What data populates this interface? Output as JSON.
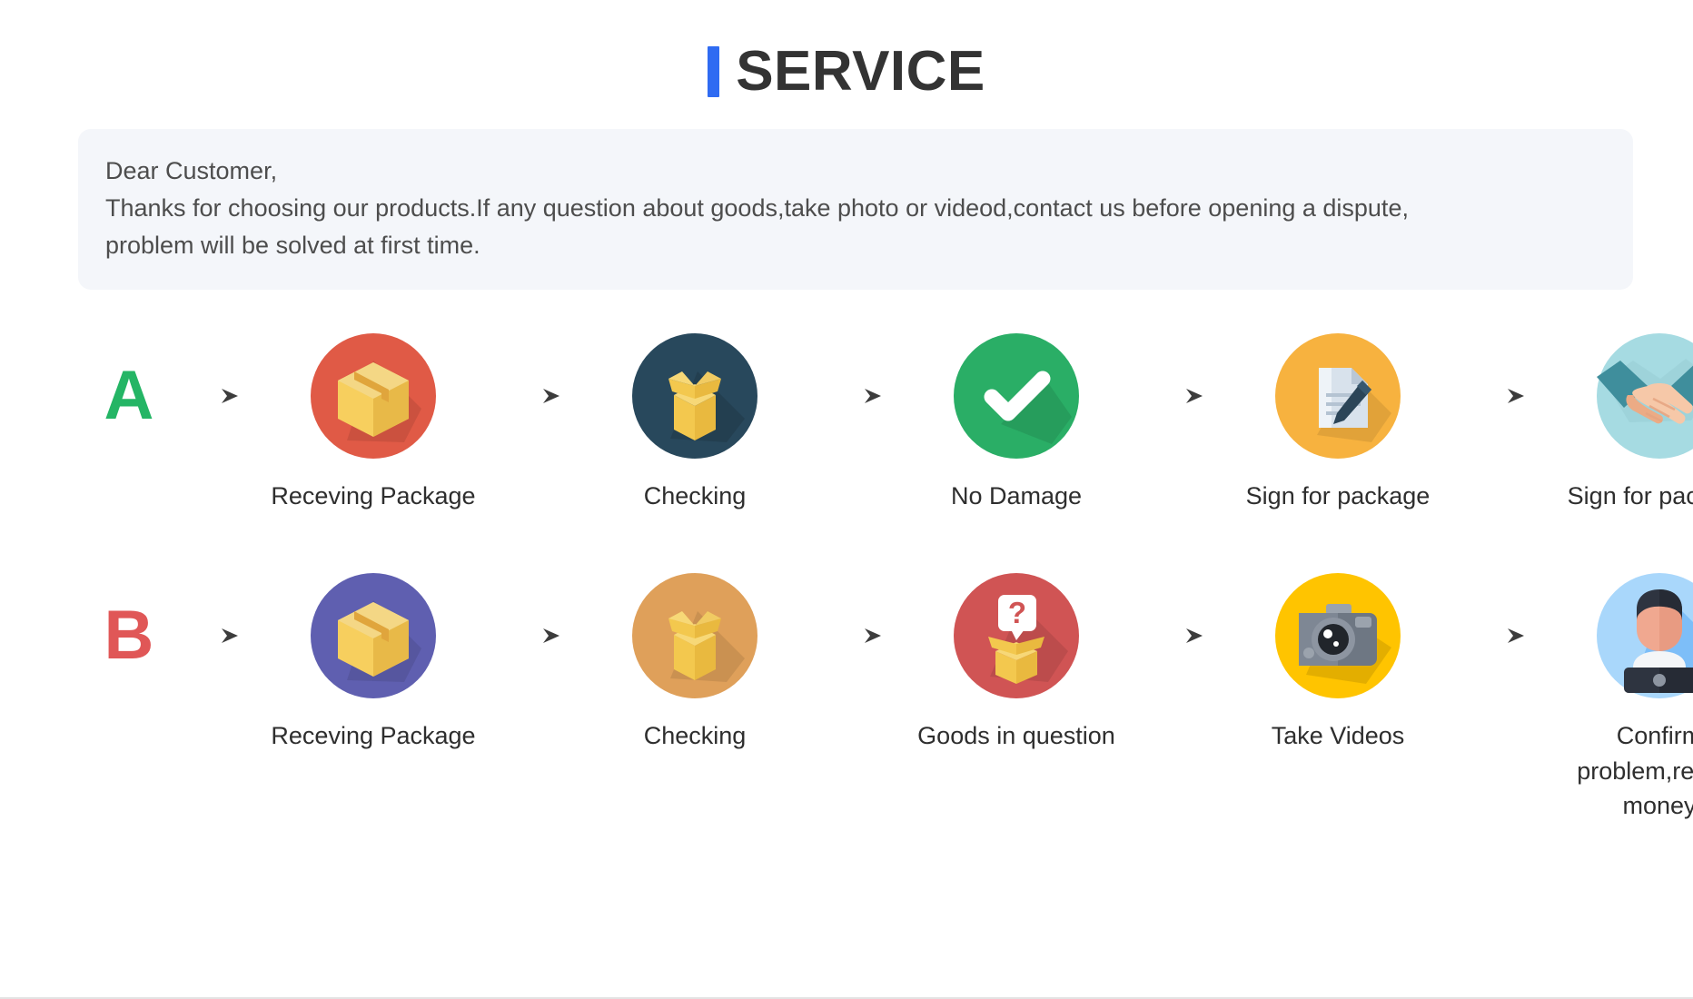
{
  "header": {
    "accent_color": "#2f6bf2",
    "title": "SERVICE"
  },
  "notice": {
    "greeting": "Dear Customer,",
    "line1": "Thanks for choosing our products.If any question about goods,take photo or videod,contact us before opening a dispute,",
    "line2": "problem will be solved at first time.",
    "background_color": "#f4f6fa"
  },
  "flows": [
    {
      "badge": "A",
      "badge_color": "#24b565",
      "steps": [
        {
          "label": "Receving Package",
          "icon": "closed-box-icon",
          "circle_color": "#e05a46"
        },
        {
          "label": "Checking",
          "icon": "open-box-icon",
          "circle_color": "#28485c"
        },
        {
          "label": "No Damage",
          "icon": "check-mark-icon",
          "circle_color": "#2aae66"
        },
        {
          "label": "Sign for package",
          "icon": "document-pen-icon",
          "circle_color": "#f7b23f"
        },
        {
          "label": "Sign for package",
          "icon": "handshake-icon",
          "circle_color": "#a6dbe2"
        }
      ]
    },
    {
      "badge": "B",
      "badge_color": "#e05757",
      "steps": [
        {
          "label": "Receving Package",
          "icon": "closed-box-icon",
          "circle_color": "#5f5fb0"
        },
        {
          "label": "Checking",
          "icon": "open-box-icon",
          "circle_color": "#dfa05a"
        },
        {
          "label": "Goods in question",
          "icon": "question-box-icon",
          "circle_color": "#d05454"
        },
        {
          "label": "Take Videos",
          "icon": "camera-icon",
          "circle_color": "#ffc400"
        },
        {
          "label": "Confirm  problem,refund money",
          "icon": "support-agent-icon",
          "circle_color": "#a9d7fb"
        }
      ]
    }
  ],
  "arrow": {
    "name": "arrow-right-icon",
    "color": "#4a4a4a"
  }
}
